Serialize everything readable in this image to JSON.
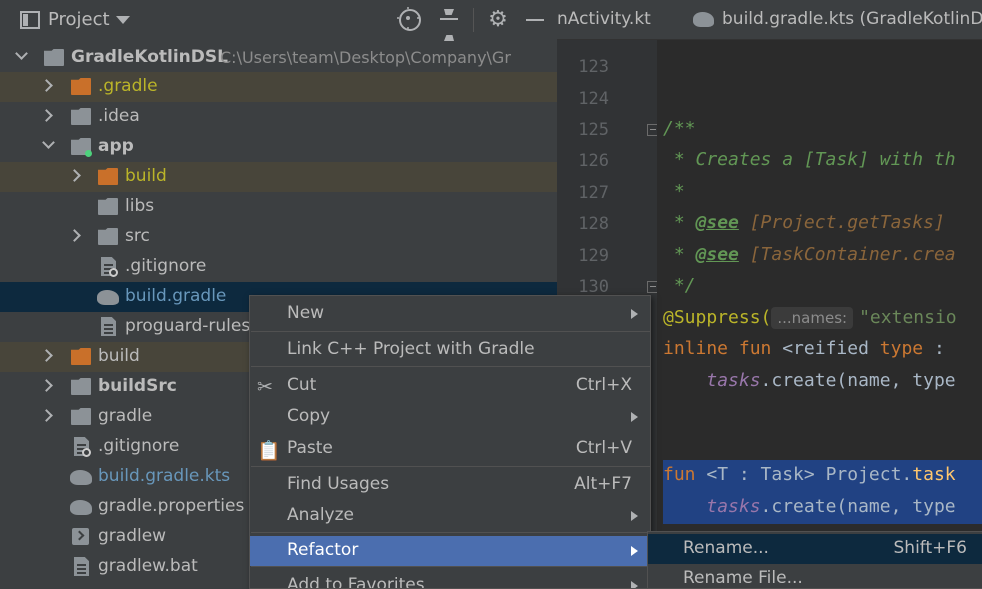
{
  "project_panel": {
    "title": "Project",
    "root": {
      "label": "GradleKotlinDSL",
      "path": "C:\\Users\\team\\Desktop\\Company\\Gr"
    },
    "items": [
      {
        "label": ".gradle"
      },
      {
        "label": ".idea"
      },
      {
        "label": "app"
      },
      {
        "label": "build"
      },
      {
        "label": "libs"
      },
      {
        "label": "src"
      },
      {
        "label": ".gitignore"
      },
      {
        "label": "build.gradle"
      },
      {
        "label": "proguard-rules."
      },
      {
        "label": "build"
      },
      {
        "label": "buildSrc"
      },
      {
        "label": "gradle"
      },
      {
        "label": ".gitignore"
      },
      {
        "label": "build.gradle.kts"
      },
      {
        "label": "gradle.properties"
      },
      {
        "label": "gradlew"
      },
      {
        "label": "gradlew.bat"
      }
    ]
  },
  "editor": {
    "tabs": [
      {
        "label": "nActivity.kt"
      },
      {
        "label": "build.gradle.kts (GradleKotlinDSL"
      }
    ],
    "line_numbers": [
      "123",
      "124",
      "125",
      "126",
      "127",
      "128",
      "129",
      "130"
    ],
    "code": {
      "l125": "/**",
      "l126": " * Creates a [Task] with th",
      "l127": " *",
      "l128_star": " * ",
      "l128_tag": "@see",
      "l128_ref": " [Project.getTasks]",
      "l129_star": " * ",
      "l129_tag": "@see",
      "l129_ref": " [TaskContainer.crea",
      "l130": " */",
      "suppress_ann": "@Suppress(",
      "suppress_hint": "...names:",
      "suppress_str": "\"extensio",
      "inline_kw": "inline fun ",
      "inline_rest": "<reified ",
      "inline_type": "type",
      "inline_colon": " :",
      "tasks_ext": "tasks",
      "tasks_rest": ".create(name, type",
      "fun_kw": "fun ",
      "fun_rest": "<T : Task> Project.",
      "fun_name": "task",
      "tasks2_ext": "tasks",
      "tasks2_rest": ".create(name, type"
    }
  },
  "context_menu": {
    "items": [
      {
        "label": "New",
        "shortcut": ""
      },
      {
        "label": "Link C++ Project with Gradle",
        "shortcut": ""
      },
      {
        "label": "Cut",
        "shortcut": "Ctrl+X"
      },
      {
        "label": "Copy",
        "shortcut": ""
      },
      {
        "label": "Paste",
        "shortcut": "Ctrl+V"
      },
      {
        "label": "Find Usages",
        "shortcut": "Alt+F7"
      },
      {
        "label": "Analyze",
        "shortcut": ""
      },
      {
        "label": "Refactor",
        "shortcut": ""
      },
      {
        "label": "Add to Favorites",
        "shortcut": ""
      }
    ]
  },
  "refactor_submenu": {
    "items": [
      {
        "label": "Rename...",
        "shortcut": "Shift+F6"
      },
      {
        "label": "Rename File...",
        "shortcut": ""
      }
    ]
  },
  "colors": {
    "panel_bg": "#3c3f41",
    "editor_bg": "#2b2b2b",
    "menu_active": "#4b6eaf",
    "excluded_folder": "#c9702a",
    "selection": "#0d293e",
    "code_highlight": "#214283"
  }
}
